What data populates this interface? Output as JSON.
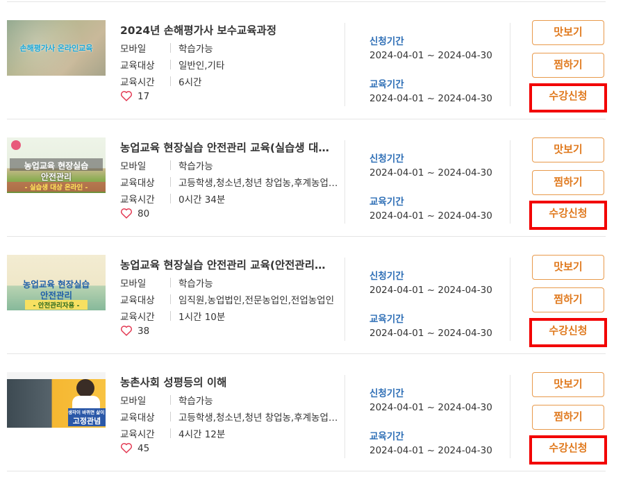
{
  "labels": {
    "mobile": "모바일",
    "target": "교육대상",
    "time": "교육시간",
    "apply_period": "신청기간",
    "edu_period": "교육기간",
    "preview_btn": "맛보기",
    "wish_btn": "찜하기",
    "apply_btn": "수강신청"
  },
  "courses": [
    {
      "title": "2024년 손해평가사 보수교육과정",
      "mobile": "학습가능",
      "target": "일반인,기타",
      "time": "6시간",
      "likes": "17",
      "apply_period": "2024-04-01 ~ 2024-04-30",
      "edu_period": "2024-04-01 ~ 2024-04-30",
      "thumb_text": "손해평가사 온라인교육"
    },
    {
      "title": "농업교육 현장실습 안전관리 교육(실습생 대상 온라인교육)",
      "mobile": "학습가능",
      "target": "고등학생,청소년,청년 창업농,후계농업경영인",
      "time": "0시간 34분",
      "likes": "80",
      "apply_period": "2024-04-01 ~ 2024-04-30",
      "edu_period": "2024-04-01 ~ 2024-04-30",
      "thumb_line1": "농업교육 현장실습",
      "thumb_line2": "안전관리",
      "thumb_line3": "- 실습생 대상 온라인 -"
    },
    {
      "title": "농업교육 현장실습 안전관리 교육(안전관리자용)",
      "mobile": "학습가능",
      "target": "임직원,농업법인,전문농업인,전업농업인",
      "time": "1시간 10분",
      "likes": "38",
      "apply_period": "2024-04-01 ~ 2024-04-30",
      "edu_period": "2024-04-01 ~ 2024-04-30",
      "thumb_line1": "농업교육 현장실습",
      "thumb_line2": "안전관리",
      "thumb_line3": "- 안전관리자용 -"
    },
    {
      "title": "농촌사회 성평등의 이해",
      "mobile": "학습가능",
      "target": "고등학생,청소년,청년 창업농,후계농업경영인",
      "time": "4시간 12분",
      "likes": "45",
      "apply_period": "2024-04-01 ~ 2024-04-30",
      "edu_period": "2024-04-01 ~ 2024-04-30",
      "thumb_line1": "생각이 바뀌면 삶이 바뀐다",
      "thumb_line2": "고정관념"
    }
  ],
  "colors": {
    "accent_orange": "#e07a1f",
    "label_blue": "#2f6fb6",
    "highlight_red": "#f20000",
    "heart": "#e2354f"
  }
}
